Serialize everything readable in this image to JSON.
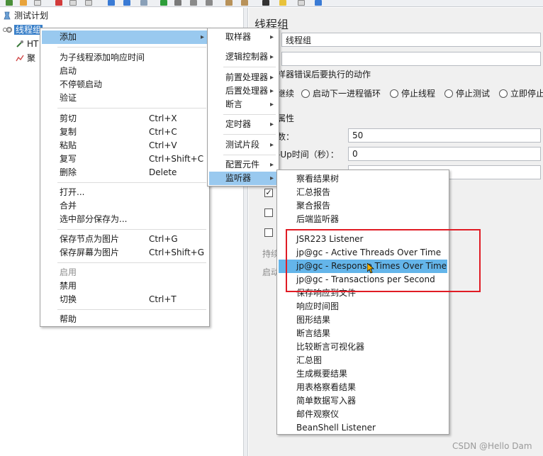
{
  "tree": {
    "root_label": "测试计划",
    "thread_group_label": "线程组",
    "child1_label": "HT",
    "child2_label": "聚"
  },
  "thread_group_panel": {
    "title": "线程组",
    "name_value": "线程组",
    "comment_value": "",
    "sampler_error_heading": "样器错误后要执行的动作",
    "actions": [
      "继续",
      "启动下一进程循环",
      "停止线程",
      "停止测试",
      "立即停止"
    ],
    "properties_heading": "属性",
    "threads_label": "数：",
    "threads_value": "50",
    "rampup_label": "-Up时间（秒）：",
    "rampup_value": "0",
    "row3_label": "...",
    "duration_label": "持续",
    "startup_label": "启动"
  },
  "context_menu": {
    "items": [
      {
        "label": "添加",
        "has_submenu": true,
        "highlighted": true
      },
      {
        "label": "为子线程添加响应时间"
      },
      {
        "label": "启动"
      },
      {
        "label": "不停顿启动"
      },
      {
        "label": "验证"
      },
      {
        "label": "剪切",
        "accel": "Ctrl+X"
      },
      {
        "label": "复制",
        "accel": "Ctrl+C"
      },
      {
        "label": "粘贴",
        "accel": "Ctrl+V"
      },
      {
        "label": "复写",
        "accel": "Ctrl+Shift+C"
      },
      {
        "label": "删除",
        "accel": "Delete"
      },
      {
        "label": "打开..."
      },
      {
        "label": "合并"
      },
      {
        "label": "选中部分保存为..."
      },
      {
        "label": "保存节点为图片",
        "accel": "Ctrl+G"
      },
      {
        "label": "保存屏幕为图片",
        "accel": "Ctrl+Shift+G"
      },
      {
        "label": "启用",
        "disabled": true
      },
      {
        "label": "禁用"
      },
      {
        "label": "切换",
        "accel": "Ctrl+T"
      },
      {
        "label": "帮助"
      }
    ]
  },
  "add_submenu": {
    "items": [
      {
        "label": "取样器"
      },
      {
        "label": "逻辑控制器"
      },
      {
        "label": "前置处理器"
      },
      {
        "label": "后置处理器"
      },
      {
        "label": "断言"
      },
      {
        "label": "定时器"
      },
      {
        "label": "测试片段"
      },
      {
        "label": "配置元件"
      },
      {
        "label": "监听器",
        "highlighted": true
      }
    ]
  },
  "listener_submenu": {
    "items": [
      {
        "label": "察看结果树"
      },
      {
        "label": "汇总报告"
      },
      {
        "label": "聚合报告"
      },
      {
        "label": "后端监听器"
      },
      {
        "label": "JSR223 Listener"
      },
      {
        "label": "jp@gc - Active Threads Over Time"
      },
      {
        "label": "jp@gc - Response Times Over Time",
        "highlighted": true
      },
      {
        "label": "jp@gc - Transactions per Second"
      },
      {
        "label": "保存响应到文件"
      },
      {
        "label": "响应时间图"
      },
      {
        "label": "图形结果"
      },
      {
        "label": "断言结果"
      },
      {
        "label": "比较断言可视化器"
      },
      {
        "label": "汇总图"
      },
      {
        "label": "生成概要结果"
      },
      {
        "label": "用表格察看结果"
      },
      {
        "label": "简单数据写入器"
      },
      {
        "label": "邮件观察仪"
      },
      {
        "label": "BeanShell Listener"
      }
    ]
  },
  "watermark": "CSDN @Hello Dam",
  "colors": {
    "menu_highlight": "#99c9ef",
    "selected_item": "#64b5ea",
    "annotation_box": "#e01b24"
  }
}
